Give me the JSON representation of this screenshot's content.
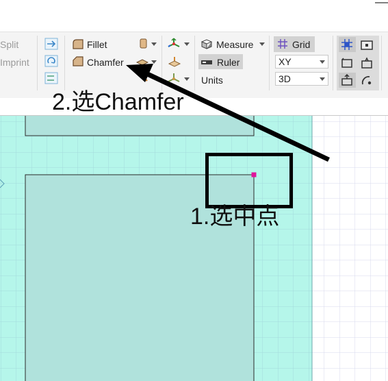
{
  "ribbon": {
    "left_tools": {
      "split_label": "Split",
      "imprint_label": "Imprint"
    },
    "fillet_label": "Fillet",
    "chamfer_label": "Chamfer",
    "measure_label": "Measure",
    "ruler_label": "Ruler",
    "units_label": "Units",
    "grid_label": "Grid",
    "plane_select": {
      "value": "XY"
    },
    "view_select": {
      "value": "3D"
    }
  },
  "annotations": {
    "step1": "1.选中点",
    "step2": "2.选Chamfer"
  },
  "colors": {
    "canvas_bg": "#b5f6ea",
    "grid_line": "#a3d9dc",
    "face_fill": "#b0e2dc",
    "point_marker": "#e0159b",
    "annotation_ink": "#000000"
  }
}
